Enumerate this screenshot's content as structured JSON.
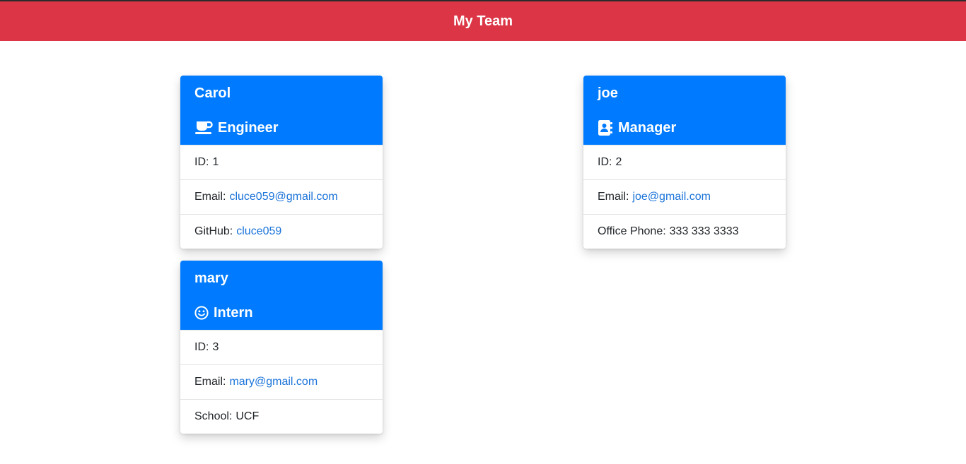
{
  "header": {
    "title": "My Team"
  },
  "colors": {
    "header_bg": "#dc3545",
    "card_head_bg": "#007bff",
    "link": "#1a73d9"
  },
  "cards": [
    {
      "name": "Carol",
      "role": "Engineer",
      "role_icon": "coffee-mug-icon",
      "id_label": "ID:",
      "id": "1",
      "email_label": "Email:",
      "email": "cluce059@gmail.com",
      "extra_label": "GitHub:",
      "extra": "cluce059"
    },
    {
      "name": "mary",
      "role": "Intern",
      "role_icon": "smiley-face-icon",
      "id_label": "ID:",
      "id": "3",
      "email_label": "Email:",
      "email": "mary@gmail.com",
      "extra_label": "School:",
      "extra": "UCF"
    },
    {
      "name": "joe",
      "role": "Manager",
      "role_icon": "address-book-icon",
      "id_label": "ID:",
      "id": "2",
      "email_label": "Email:",
      "email": "joe@gmail.com",
      "extra_label": "Office Phone:",
      "extra": "333 333 3333"
    }
  ]
}
